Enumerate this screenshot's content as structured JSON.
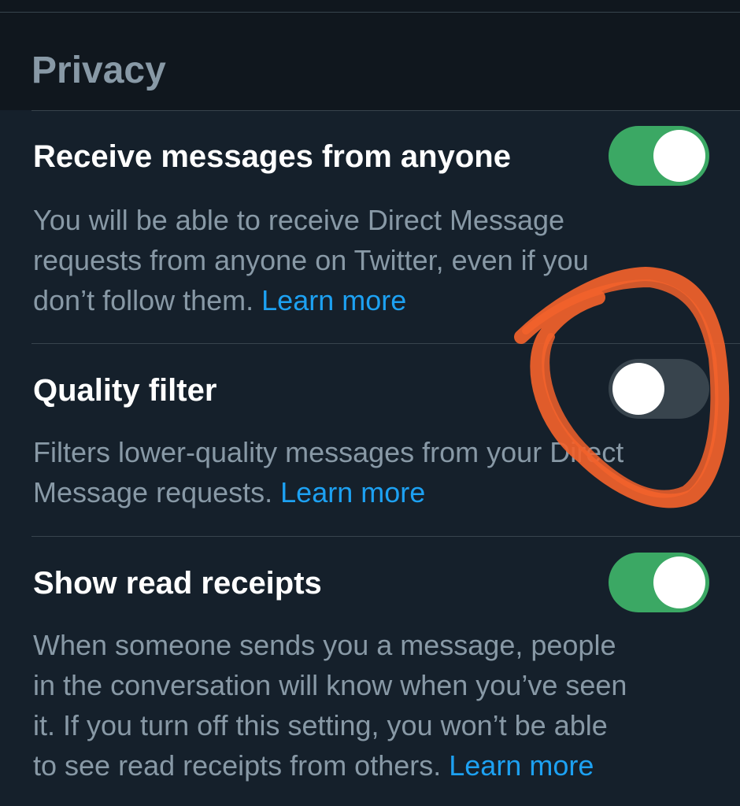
{
  "section": {
    "title": "Privacy"
  },
  "settings": [
    {
      "title": "Receive messages from anyone",
      "description_lines": [
        "You will be able to receive Direct Message",
        "requests from anyone on Twitter, even if you",
        "don’t follow them. "
      ],
      "link": "Learn more",
      "toggle_on": true
    },
    {
      "title": "Quality filter",
      "description_lines": [
        "Filters lower-quality messages from your Direct",
        "Message requests. "
      ],
      "link": "Learn more",
      "toggle_on": false
    },
    {
      "title": "Show read receipts",
      "description_lines": [
        "When someone sends you a message, people",
        "in the conversation will know when you’ve seen",
        "it. If you turn off this setting, you won’t be able",
        "to see read receipts from others. "
      ],
      "link": "Learn more",
      "toggle_on": true
    }
  ],
  "colors": {
    "background": "#15202b",
    "header_background": "#10171e",
    "toggle_on": "#3ba864",
    "toggle_off": "#38444d",
    "link": "#1da1f2",
    "annotation_circle": "#f2622b"
  },
  "annotation": {
    "shape": "hand-drawn circle",
    "target": "quality-filter-toggle"
  }
}
